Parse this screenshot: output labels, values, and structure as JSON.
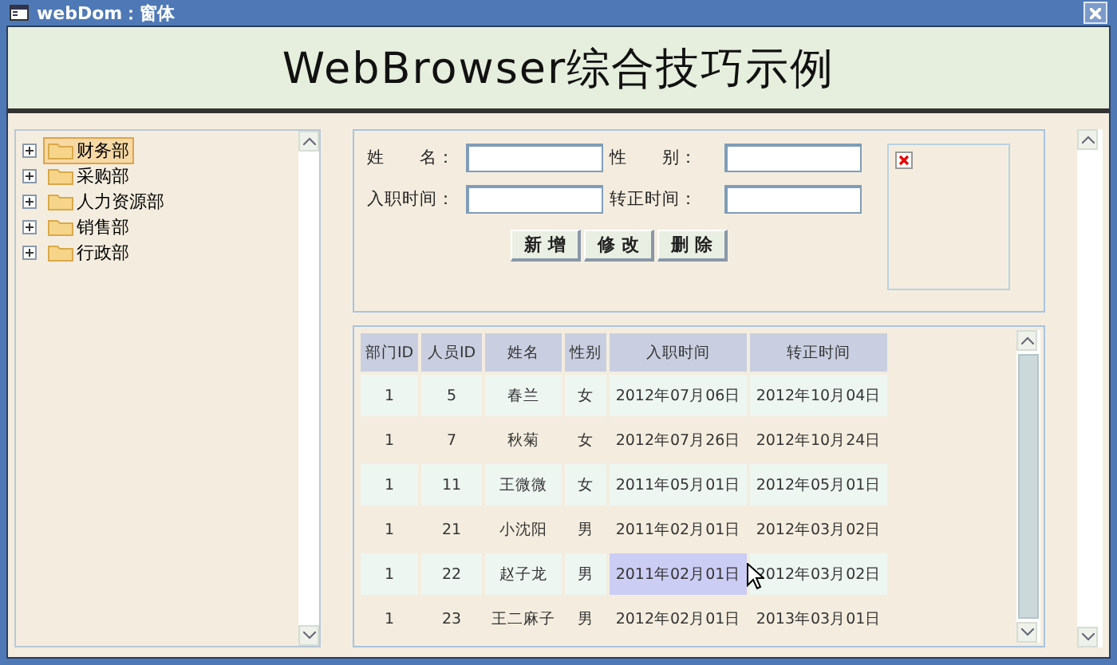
{
  "window": {
    "title": "webDom：窗体"
  },
  "header": {
    "title": "WebBrowser综合技巧示例"
  },
  "tree": {
    "items": [
      {
        "label": "财务部",
        "selected": true
      },
      {
        "label": "采购部",
        "selected": false
      },
      {
        "label": "人力资源部",
        "selected": false
      },
      {
        "label": "销售部",
        "selected": false
      },
      {
        "label": "行政部",
        "selected": false
      }
    ]
  },
  "form": {
    "fields": [
      {
        "label": "姓　　名："
      },
      {
        "label": "性　　别："
      },
      {
        "label": "入职时间："
      },
      {
        "label": "转正时间："
      }
    ],
    "buttons": [
      "新 增",
      "修 改",
      "删 除"
    ]
  },
  "table": {
    "columns": [
      "部门ID",
      "人员ID",
      "姓名",
      "性别",
      "入职时间",
      "转正时间"
    ],
    "rows": [
      {
        "cells": [
          {
            "text": "1",
            "selected": false
          },
          {
            "text": "5",
            "selected": false
          },
          {
            "text": "春兰",
            "selected": false
          },
          {
            "text": "女",
            "selected": false
          },
          {
            "text": "2012年07月06日",
            "selected": false
          },
          {
            "text": "2012年10月04日",
            "selected": false
          }
        ]
      },
      {
        "cells": [
          {
            "text": "1",
            "selected": false
          },
          {
            "text": "7",
            "selected": false
          },
          {
            "text": "秋菊",
            "selected": false
          },
          {
            "text": "女",
            "selected": false
          },
          {
            "text": "2012年07月26日",
            "selected": false
          },
          {
            "text": "2012年10月24日",
            "selected": false
          }
        ]
      },
      {
        "cells": [
          {
            "text": "1",
            "selected": false
          },
          {
            "text": "11",
            "selected": false
          },
          {
            "text": "王微微",
            "selected": false
          },
          {
            "text": "女",
            "selected": false
          },
          {
            "text": "2011年05月01日",
            "selected": false
          },
          {
            "text": "2012年05月01日",
            "selected": false
          }
        ]
      },
      {
        "cells": [
          {
            "text": "1",
            "selected": false
          },
          {
            "text": "21",
            "selected": false
          },
          {
            "text": "小沈阳",
            "selected": false
          },
          {
            "text": "男",
            "selected": false
          },
          {
            "text": "2011年02月01日",
            "selected": false
          },
          {
            "text": "2012年03月02日",
            "selected": false
          }
        ]
      },
      {
        "cells": [
          {
            "text": "1",
            "selected": false
          },
          {
            "text": "22",
            "selected": false
          },
          {
            "text": "赵子龙",
            "selected": false
          },
          {
            "text": "男",
            "selected": false
          },
          {
            "text": "2011年02月01日",
            "selected": true
          },
          {
            "text": "2012年03月02日",
            "selected": false
          }
        ]
      },
      {
        "cells": [
          {
            "text": "1",
            "selected": false
          },
          {
            "text": "23",
            "selected": false
          },
          {
            "text": "王二麻子",
            "selected": false
          },
          {
            "text": "男",
            "selected": false
          },
          {
            "text": "2012年02月01日",
            "selected": false
          },
          {
            "text": "2013年03月01日",
            "selected": false
          }
        ]
      }
    ]
  }
}
